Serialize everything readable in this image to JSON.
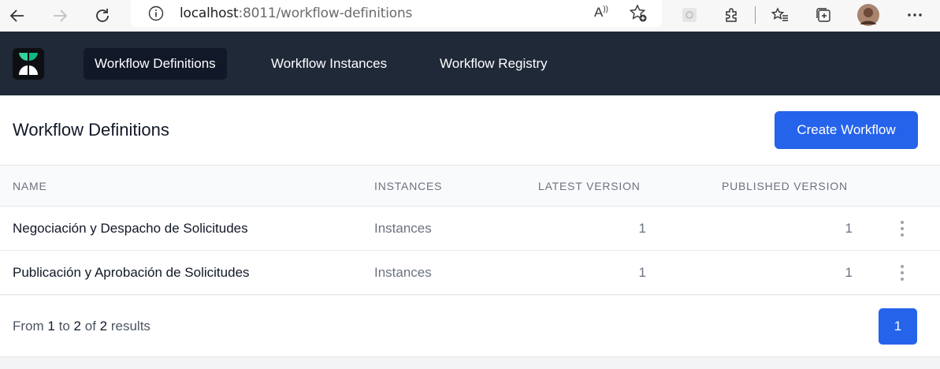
{
  "browser": {
    "url_host": "localhost",
    "url_rest": ":8011/workflow-definitions"
  },
  "nav": {
    "items": [
      {
        "label": "Workflow Definitions",
        "active": true
      },
      {
        "label": "Workflow Instances",
        "active": false
      },
      {
        "label": "Workflow Registry",
        "active": false
      }
    ]
  },
  "page": {
    "title": "Workflow Definitions",
    "create_label": "Create Workflow"
  },
  "table": {
    "headers": [
      "NAME",
      "INSTANCES",
      "LATEST VERSION",
      "PUBLISHED VERSION"
    ],
    "rows": [
      {
        "name": "Negociación y Despacho de Solicitudes",
        "instances": "Instances",
        "latest": "1",
        "published": "1"
      },
      {
        "name": "Publicación y Aprobación de Solicitudes",
        "instances": "Instances",
        "latest": "1",
        "published": "1"
      }
    ]
  },
  "pagination": {
    "from_text": "From",
    "from": "1",
    "to_text": "to",
    "to": "2",
    "of_text": "of",
    "total": "2",
    "results_text": "results",
    "current_page": "1"
  },
  "colors": {
    "header_bg": "#1f2937",
    "accent": "#2563eb"
  }
}
